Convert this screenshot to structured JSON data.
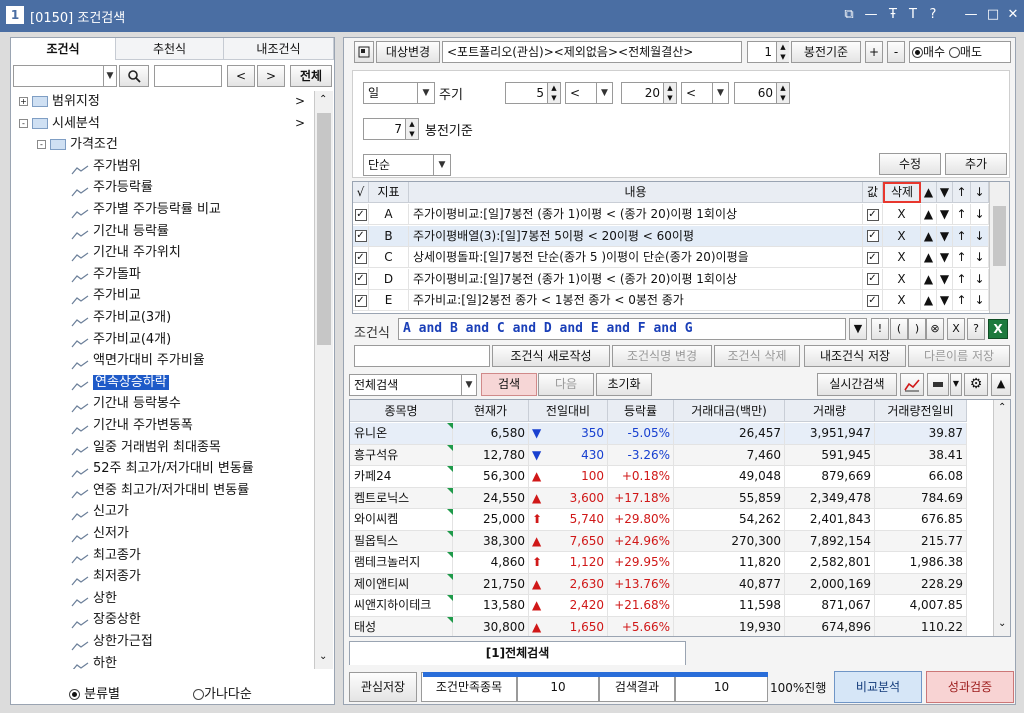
{
  "window": {
    "number": "1",
    "title": "[0150] 조건검색",
    "icons": [
      "restore-icon",
      "minimize-icon",
      "pin-icon",
      "font-icon",
      "help-icon",
      "minimize2-icon",
      "maximize-icon",
      "close-icon"
    ],
    "glyphs": [
      "⧉",
      "—",
      "Ŧ",
      "T",
      "?",
      "—",
      "□",
      "✕"
    ]
  },
  "left": {
    "tabs": [
      "조건식",
      "추천식",
      "내조건식"
    ],
    "search": {
      "value": "",
      "value2": ""
    },
    "nav_prev": "<",
    "nav_next": ">",
    "all_label": "전체",
    "tree": [
      {
        "label": "범위지정",
        "level": 0,
        "kind": "folder",
        "exp": "+",
        "arrow": ">"
      },
      {
        "label": "시세분석",
        "level": 0,
        "kind": "folder",
        "exp": "-",
        "arrow": ">"
      },
      {
        "label": "가격조건",
        "level": 1,
        "kind": "folder",
        "exp": "-",
        "arrow": ""
      },
      {
        "label": "주가범위",
        "level": 2,
        "kind": "item"
      },
      {
        "label": "주가등락률",
        "level": 2,
        "kind": "item"
      },
      {
        "label": "주가별 주가등락률 비교",
        "level": 2,
        "kind": "item"
      },
      {
        "label": "기간내 등락률",
        "level": 2,
        "kind": "item"
      },
      {
        "label": "기간내 주가위치",
        "level": 2,
        "kind": "item"
      },
      {
        "label": "주가돌파",
        "level": 2,
        "kind": "item"
      },
      {
        "label": "주가비교",
        "level": 2,
        "kind": "item"
      },
      {
        "label": "주가비교(3개)",
        "level": 2,
        "kind": "item"
      },
      {
        "label": "주가비교(4개)",
        "level": 2,
        "kind": "item"
      },
      {
        "label": "액면가대비 주가비율",
        "level": 2,
        "kind": "item"
      },
      {
        "label": "연속상승하락",
        "level": 2,
        "kind": "item",
        "selected": true
      },
      {
        "label": "기간내 등락봉수",
        "level": 2,
        "kind": "item"
      },
      {
        "label": "기간내 주가변동폭",
        "level": 2,
        "kind": "item"
      },
      {
        "label": "일중 거래범위 최대종목",
        "level": 2,
        "kind": "item"
      },
      {
        "label": "52주 최고가/저가대비 변동률",
        "level": 2,
        "kind": "item"
      },
      {
        "label": "연중 최고가/저가대비 변동률",
        "level": 2,
        "kind": "item"
      },
      {
        "label": "신고가",
        "level": 2,
        "kind": "item"
      },
      {
        "label": "신저가",
        "level": 2,
        "kind": "item"
      },
      {
        "label": "최고종가",
        "level": 2,
        "kind": "item"
      },
      {
        "label": "최저종가",
        "level": 2,
        "kind": "item"
      },
      {
        "label": "상한",
        "level": 2,
        "kind": "item"
      },
      {
        "label": "장중상한",
        "level": 2,
        "kind": "item"
      },
      {
        "label": "상한가근접",
        "level": 2,
        "kind": "item"
      },
      {
        "label": "하한",
        "level": 2,
        "kind": "item"
      }
    ],
    "radio_group": "분류별",
    "radio_alpha": "가나다순"
  },
  "target": {
    "change_label": "대상변경",
    "value": "<포트폴리오(관심)><제외없음><전체월결산>",
    "bong_value": "1",
    "bong_label": "봉전기준",
    "plus": "+",
    "minus": "-",
    "buy": "매수",
    "sell": "매도"
  },
  "params": {
    "period_value": "일",
    "period_label": "주기",
    "v1": "5",
    "op1": "<",
    "v2": "20",
    "op2": "<",
    "v3": "60",
    "bong2_value": "7",
    "bong2_label": "봉전기준",
    "type_value": "단순",
    "edit": "수정",
    "add": "추가"
  },
  "cond_table": {
    "headers": [
      "√",
      "지표",
      "내용",
      "값",
      "삭제",
      "▲",
      "▼",
      "↑",
      "↓"
    ],
    "rows": [
      {
        "id": "A",
        "content": "주가이평비교:[일]7봉전 (종가 1)이평 < (종가 20)이평 1회이상",
        "del": "X"
      },
      {
        "id": "B",
        "content": "주가이평배열(3):[일]7봉전 5이평 < 20이평 < 60이평",
        "del": "X"
      },
      {
        "id": "C",
        "content": "상세이평돌파:[일]7봉전 단순(종가 5 )이평이 단순(종가 20)이평을",
        "del": "X"
      },
      {
        "id": "D",
        "content": "주가이평비교:[일]7봉전 (종가 1)이평 < (종가 20)이평 1회이상",
        "del": "X"
      },
      {
        "id": "E",
        "content": "주가비교:[일]2봉전 종가 < 1봉전 종가 < 0봉전 종가",
        "del": "X"
      }
    ],
    "check": "✓"
  },
  "formula": {
    "label": "조건식",
    "value": "A and B and C and D and E and F and G",
    "tools": [
      "▼",
      "!",
      "(",
      ")",
      "⊗",
      "X",
      "?"
    ]
  },
  "actions": {
    "name_value": "",
    "new": "조건식 새로작성",
    "rename": "조건식명 변경",
    "delete": "조건식 삭제",
    "save": "내조건식 저장",
    "save_as": "다른이름 저장"
  },
  "search_bar": {
    "scope": "전체검색",
    "search": "검색",
    "next": "다음",
    "reset": "초기화",
    "realtime": "실시간검색"
  },
  "results": {
    "headers": [
      "종목명",
      "현재가",
      "전일대비",
      "등락률",
      "거래대금(백만)",
      "거래량",
      "거래량전일비"
    ],
    "rows": [
      {
        "name": "유니온",
        "price": "6,580",
        "dir": "down",
        "chg": "350",
        "rate": "-5.05%",
        "amount": "26,457",
        "volume": "3,951,947",
        "vratio": "39.87"
      },
      {
        "name": "흥구석유",
        "price": "12,780",
        "dir": "down",
        "chg": "430",
        "rate": "-3.26%",
        "amount": "7,460",
        "volume": "591,945",
        "vratio": "38.41"
      },
      {
        "name": "카페24",
        "price": "56,300",
        "dir": "up",
        "chg": "100",
        "rate": "+0.18%",
        "amount": "49,048",
        "volume": "879,669",
        "vratio": "66.08"
      },
      {
        "name": "켐트로닉스",
        "price": "24,550",
        "dir": "up",
        "chg": "3,600",
        "rate": "+17.18%",
        "amount": "55,859",
        "volume": "2,349,478",
        "vratio": "784.69"
      },
      {
        "name": "와이씨켐",
        "price": "25,000",
        "dir": "limit",
        "chg": "5,740",
        "rate": "+29.80%",
        "amount": "54,262",
        "volume": "2,401,843",
        "vratio": "676.85"
      },
      {
        "name": "필옵틱스",
        "price": "38,300",
        "dir": "up",
        "chg": "7,650",
        "rate": "+24.96%",
        "amount": "270,300",
        "volume": "7,892,154",
        "vratio": "215.77"
      },
      {
        "name": "램테크놀러지",
        "price": "4,860",
        "dir": "limit",
        "chg": "1,120",
        "rate": "+29.95%",
        "amount": "11,820",
        "volume": "2,582,801",
        "vratio": "1,986.38"
      },
      {
        "name": "제이앤티씨",
        "price": "21,750",
        "dir": "up",
        "chg": "2,630",
        "rate": "+13.76%",
        "amount": "40,877",
        "volume": "2,000,169",
        "vratio": "228.29"
      },
      {
        "name": "씨앤지하이테크",
        "price": "13,580",
        "dir": "up",
        "chg": "2,420",
        "rate": "+21.68%",
        "amount": "11,598",
        "volume": "871,067",
        "vratio": "4,007.85"
      },
      {
        "name": "태성",
        "price": "30,800",
        "dir": "up",
        "chg": "1,650",
        "rate": "+5.66%",
        "amount": "19,930",
        "volume": "674,896",
        "vratio": "110.22"
      }
    ],
    "tab": "[1]전체검색"
  },
  "footer": {
    "watch_save": "관심저장",
    "match_label": "조건만족종목",
    "match_value": "10",
    "result_label": "검색결과",
    "result_value": "10",
    "progress_label": "100%진행",
    "progress": 1.0,
    "compare": "비교분석",
    "verify": "성과검증"
  },
  "colors": {
    "title": "#4a6ea3",
    "up": "#d01818",
    "down": "#1840d0",
    "selected": "#1e5ac8",
    "highlight": "#e8372e"
  }
}
